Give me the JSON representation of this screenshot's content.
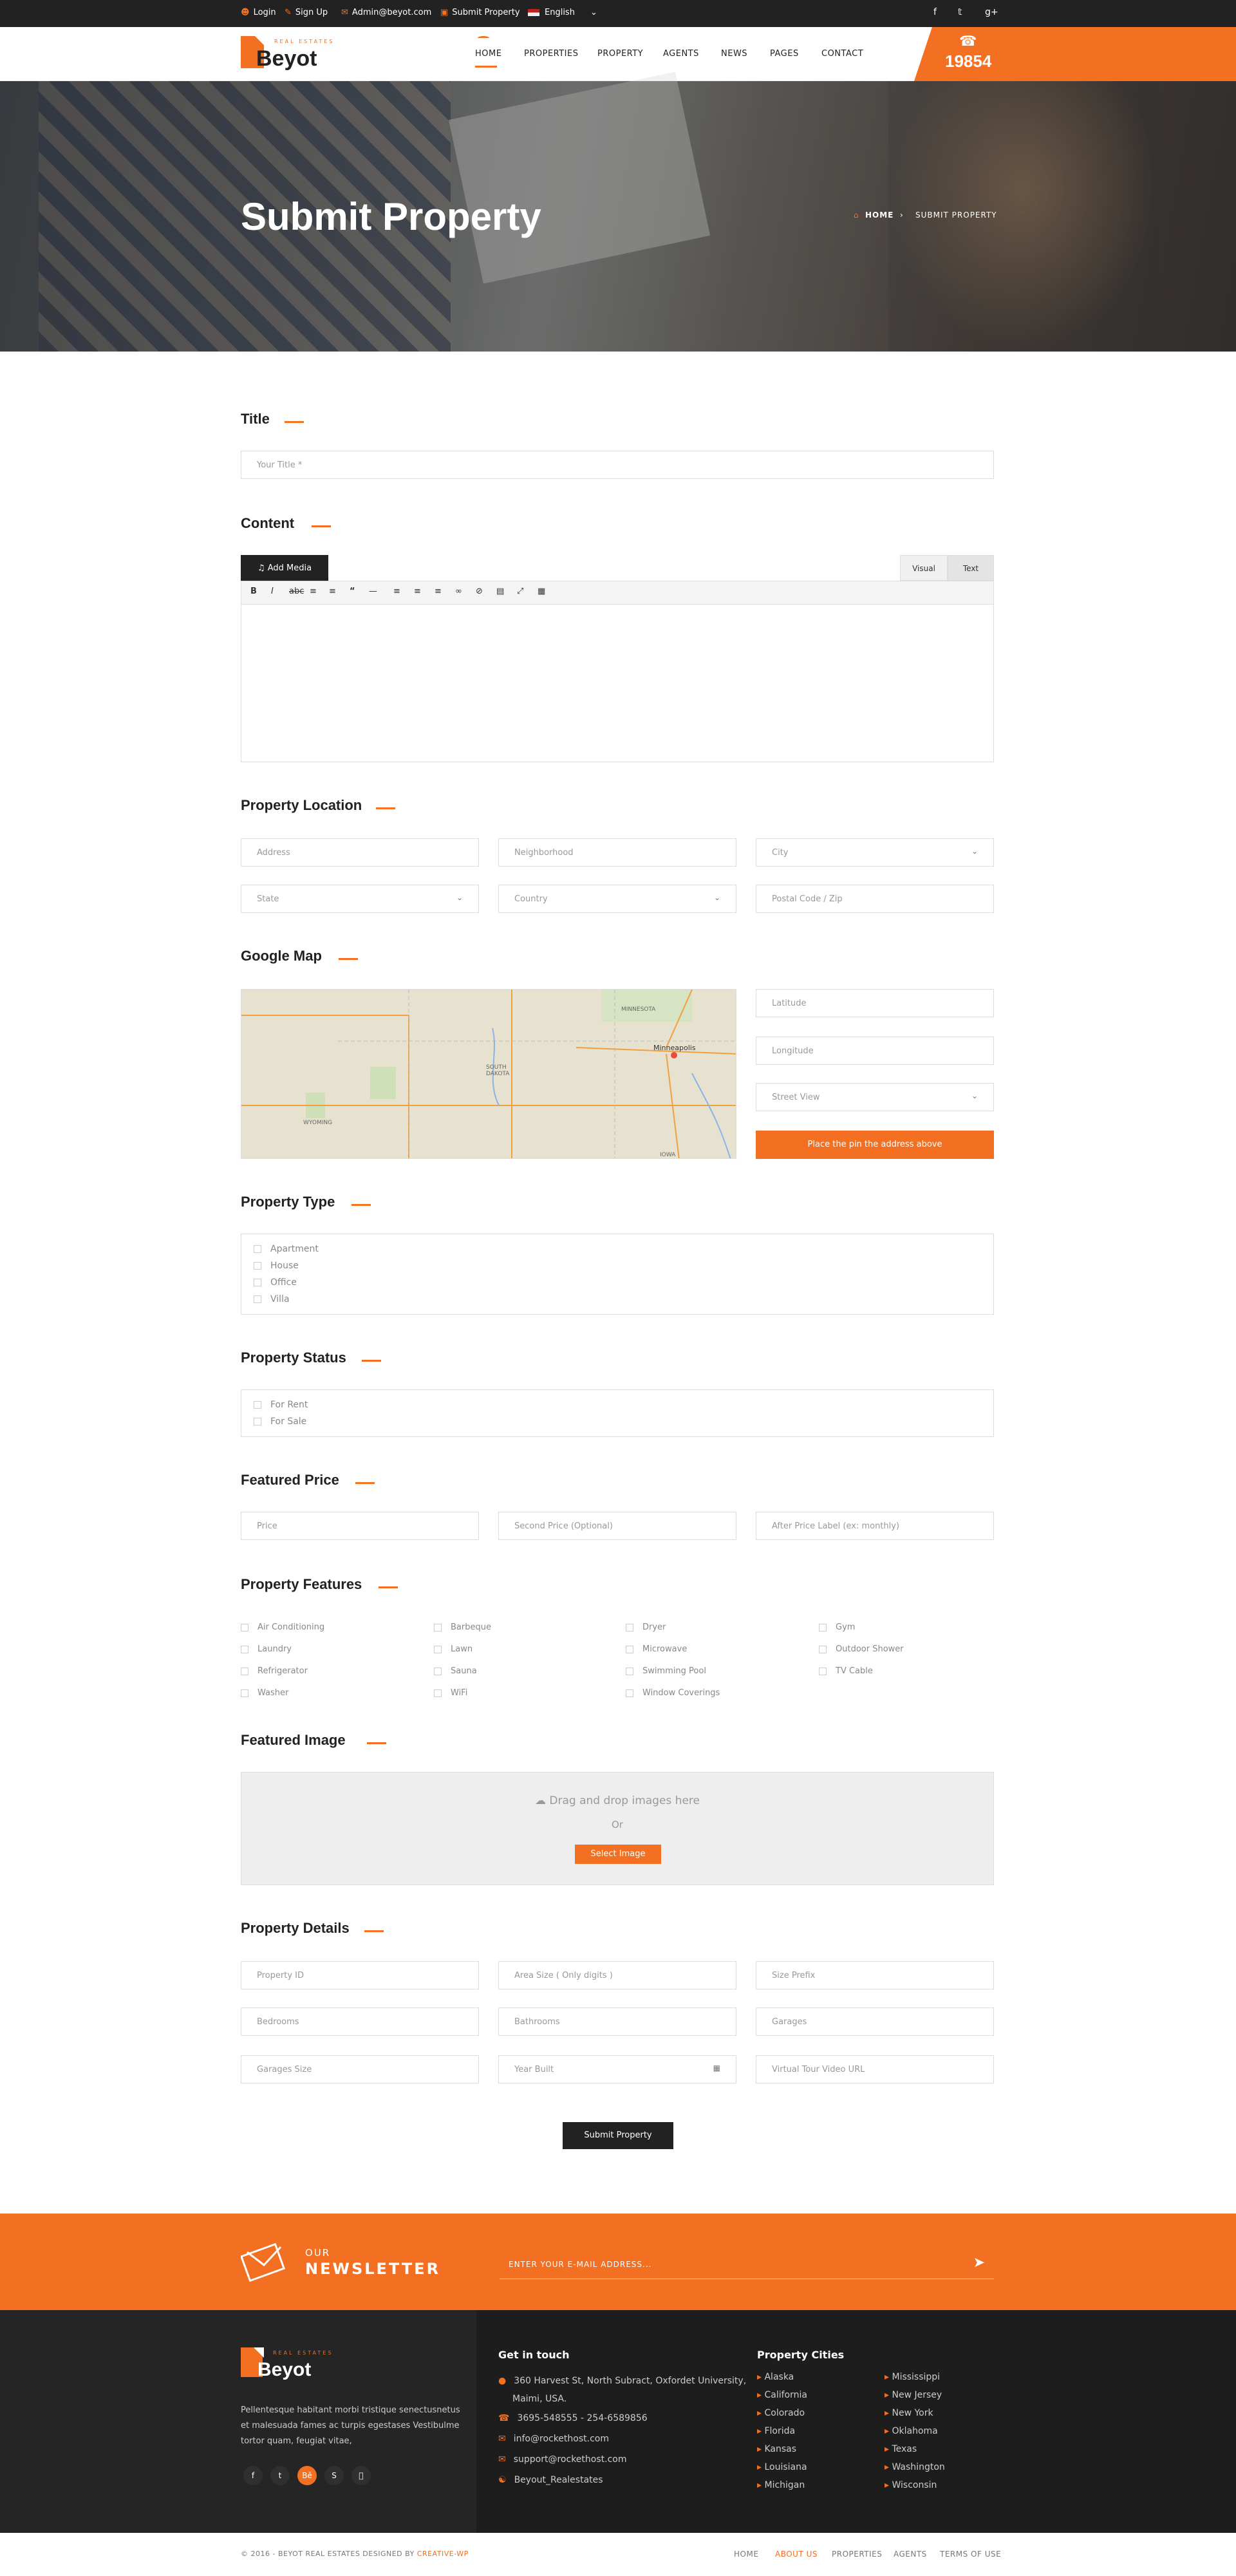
{
  "topbar": {
    "login": "Login",
    "signup": "Sign Up",
    "email": "Admin@beyot.com",
    "submit": "Submit Property",
    "language": "English"
  },
  "logo": {
    "name": "Beyot",
    "tagline": "REAL ESTATES"
  },
  "nav": [
    "HOME",
    "PROPERTIES",
    "PROPERTY",
    "AGENTS",
    "NEWS",
    "PAGES",
    "CONTACT"
  ],
  "phone": "19854",
  "hero": {
    "title": "Submit Property",
    "crumb_home": "HOME",
    "crumb_current": "SUBMIT PROPERTY"
  },
  "sections": {
    "title": "Title",
    "content": "Content",
    "location": "Property Location",
    "map": "Google Map",
    "type": "Property Type",
    "status": "Property Status",
    "price": "Featured Price",
    "features": "Property Features",
    "image": "Featured Image",
    "details": "Property Details"
  },
  "title_field": {
    "placeholder": "Your Title *"
  },
  "editor": {
    "add_media": "Add Media",
    "tab_visual": "Visual",
    "tab_text": "Text"
  },
  "location": {
    "address": "Address",
    "neighborhood": "Neighborhood",
    "city": "City",
    "state": "State",
    "country": "Country",
    "postal": "Postal Code / Zip"
  },
  "map": {
    "latitude": "Latitude",
    "longitude": "Longitude",
    "street_view": "Street View",
    "pin_button": "Place the pin the address above",
    "labels": {
      "minnesota": "MINNESOTA",
      "minneapolis": "Minneapolis",
      "south_dakota": "SOUTH DAKOTA",
      "wyoming": "WYOMING",
      "iowa": "IOWA"
    }
  },
  "types": [
    "Apartment",
    "House",
    "Office",
    "Villa"
  ],
  "statuses": [
    "For Rent",
    "For Sale"
  ],
  "price": {
    "price": "Price",
    "second": "Second Price (Optional)",
    "after": "After Price Label (ex: monthly)"
  },
  "features": [
    [
      "Air Conditioning",
      "Barbeque",
      "Dryer",
      "Gym"
    ],
    [
      "Laundry",
      "Lawn",
      "Microwave",
      "Outdoor Shower"
    ],
    [
      "Refrigerator",
      "Sauna",
      "Swimming Pool",
      "TV Cable"
    ],
    [
      "Washer",
      "WiFi",
      "Window Coverings",
      ""
    ]
  ],
  "image": {
    "drop_text": "Drag and drop images here",
    "or": "Or",
    "button": "Select Image"
  },
  "details": {
    "id": "Property ID",
    "area": "Area Size ( Only digits )",
    "size_prefix": "Size Prefix",
    "bedrooms": "Bedrooms",
    "bathrooms": "Bathrooms",
    "garages": "Garages",
    "garages_size": "Garages Size",
    "year": "Year Built",
    "video": "Virtual Tour Video URL"
  },
  "submit_button": "Submit Property",
  "newsletter": {
    "line1": "OUR",
    "line2": "NEWSLETTER",
    "placeholder": "ENTER YOUR E-MAIL ADDRESS..."
  },
  "footer": {
    "about": [
      "Pellentesque habitant morbi tristique senectusnetus",
      "et malesuada fames ac turpis egestases Vestibulme",
      "tortor quam, feugiat vitae,"
    ],
    "contact_title": "Get in touch",
    "address1": "360 Harvest St, North Subract, Oxfordet University,",
    "address2": "Maimi, USA.",
    "phones": "3695-548555  -  254-6589856",
    "email1": "info@rockethost.com",
    "email2": "support@rockethost.com",
    "skype": "Beyout_Realestates",
    "cities_title": "Property Cities",
    "cities_left": [
      "Alaska",
      "California",
      "Colorado",
      "Florida",
      "Kansas",
      "Louisiana",
      "Michigan"
    ],
    "cities_right": [
      "Mississippi",
      "New Jersey",
      "New York",
      "Oklahoma",
      "Texas",
      "Washington",
      "Wisconsin"
    ]
  },
  "bottom": {
    "copyright_prefix": "© 2016 - BEYOT REAL ESTATES DESIGNED BY ",
    "copyright_brand": "CREATIVE-WP",
    "links": [
      "HOME",
      "ABOUT US",
      "PROPERTIES",
      "AGENTS",
      "TERMS OF USE"
    ]
  },
  "colors": {
    "accent": "#f36f21",
    "dark": "#222222"
  }
}
